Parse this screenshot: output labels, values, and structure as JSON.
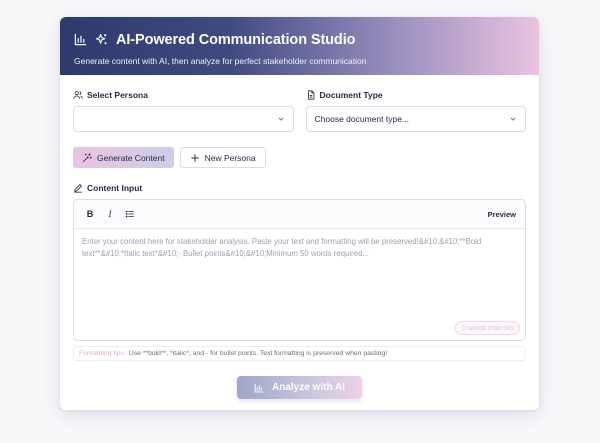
{
  "header": {
    "title": "AI-Powered Communication Studio",
    "subtitle": "Generate content with AI, then analyze for perfect stakeholder communication"
  },
  "persona": {
    "label": "Select Persona",
    "value": ""
  },
  "document_type": {
    "label": "Document Type",
    "value": "Choose document type..."
  },
  "actions": {
    "generate_label": "Generate Content",
    "new_persona_label": "New Persona"
  },
  "content_input": {
    "label": "Content Input",
    "toolbar": {
      "bold": "B",
      "italic": "I",
      "preview": "Preview"
    },
    "placeholder": "Enter your content here for stakeholder analysis. Paste your text and formatting will be preserved!&#10;&#10;**Bold text**&#10;*Italic text*&#10;- Bullet points&#10;&#10;Minimum 50 words required...",
    "word_count": "0 words (min 50)"
  },
  "tips": {
    "key": "Formatting tips:",
    "text": "Use **bold**, *italic*, and - for bullet points. Text formatting is preserved when pasting!"
  },
  "analyze": {
    "label": "Analyze with AI"
  },
  "colors": {
    "header_start": "#2e3a6e",
    "header_end": "#ebc3e0",
    "accent_pink": "#ebc3e0",
    "text_dark": "#1f2a44"
  }
}
